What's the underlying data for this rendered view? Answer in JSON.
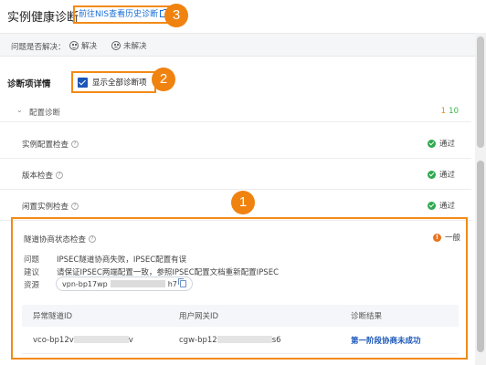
{
  "header": {
    "title": "实例健康诊断",
    "history_link": "前往NIS查看历史诊断"
  },
  "callouts": [
    "1",
    "2",
    "3"
  ],
  "resolve": {
    "question": "问题是否解决：",
    "yes_label": "解决",
    "no_label": "未解决"
  },
  "diagnosis": {
    "heading": "诊断项详情",
    "show_all_label": "显示全部诊断项"
  },
  "group": {
    "name": "配置诊断",
    "warn_count": "1",
    "ok_count": "10"
  },
  "checks": [
    {
      "name": "实例配置检查",
      "status": "通过"
    },
    {
      "name": "版本检查",
      "status": "通过"
    },
    {
      "name": "闲置实例检查",
      "status": "通过"
    }
  ],
  "failed_check": {
    "name": "隧道协商状态检查",
    "level": "一般",
    "problem_label": "问题",
    "problem": "IPSEC隧道协商失败，IPSEC配置有误",
    "advice_label": "建议",
    "advice": "请保证IPSEC两端配置一致，参照IPSEC配置文档重新配置IPSEC",
    "resource_label": "资源",
    "resource_prefix": "vpn-bp17wp",
    "resource_suffix": "h7",
    "table": {
      "headers": [
        "异常隧道ID",
        "用户网关ID",
        "诊断结果"
      ],
      "rows": [
        {
          "tunnel_prefix": "vco-bp12v",
          "tunnel_suffix": "v",
          "gateway_prefix": "cgw-bp12",
          "gateway_suffix": "s6",
          "result": "第一阶段协商未成功"
        }
      ]
    }
  },
  "colors": {
    "accent": "#f28a17",
    "link": "#1a6fd6",
    "ok": "#2fa84f",
    "warn": "#e9731e"
  }
}
